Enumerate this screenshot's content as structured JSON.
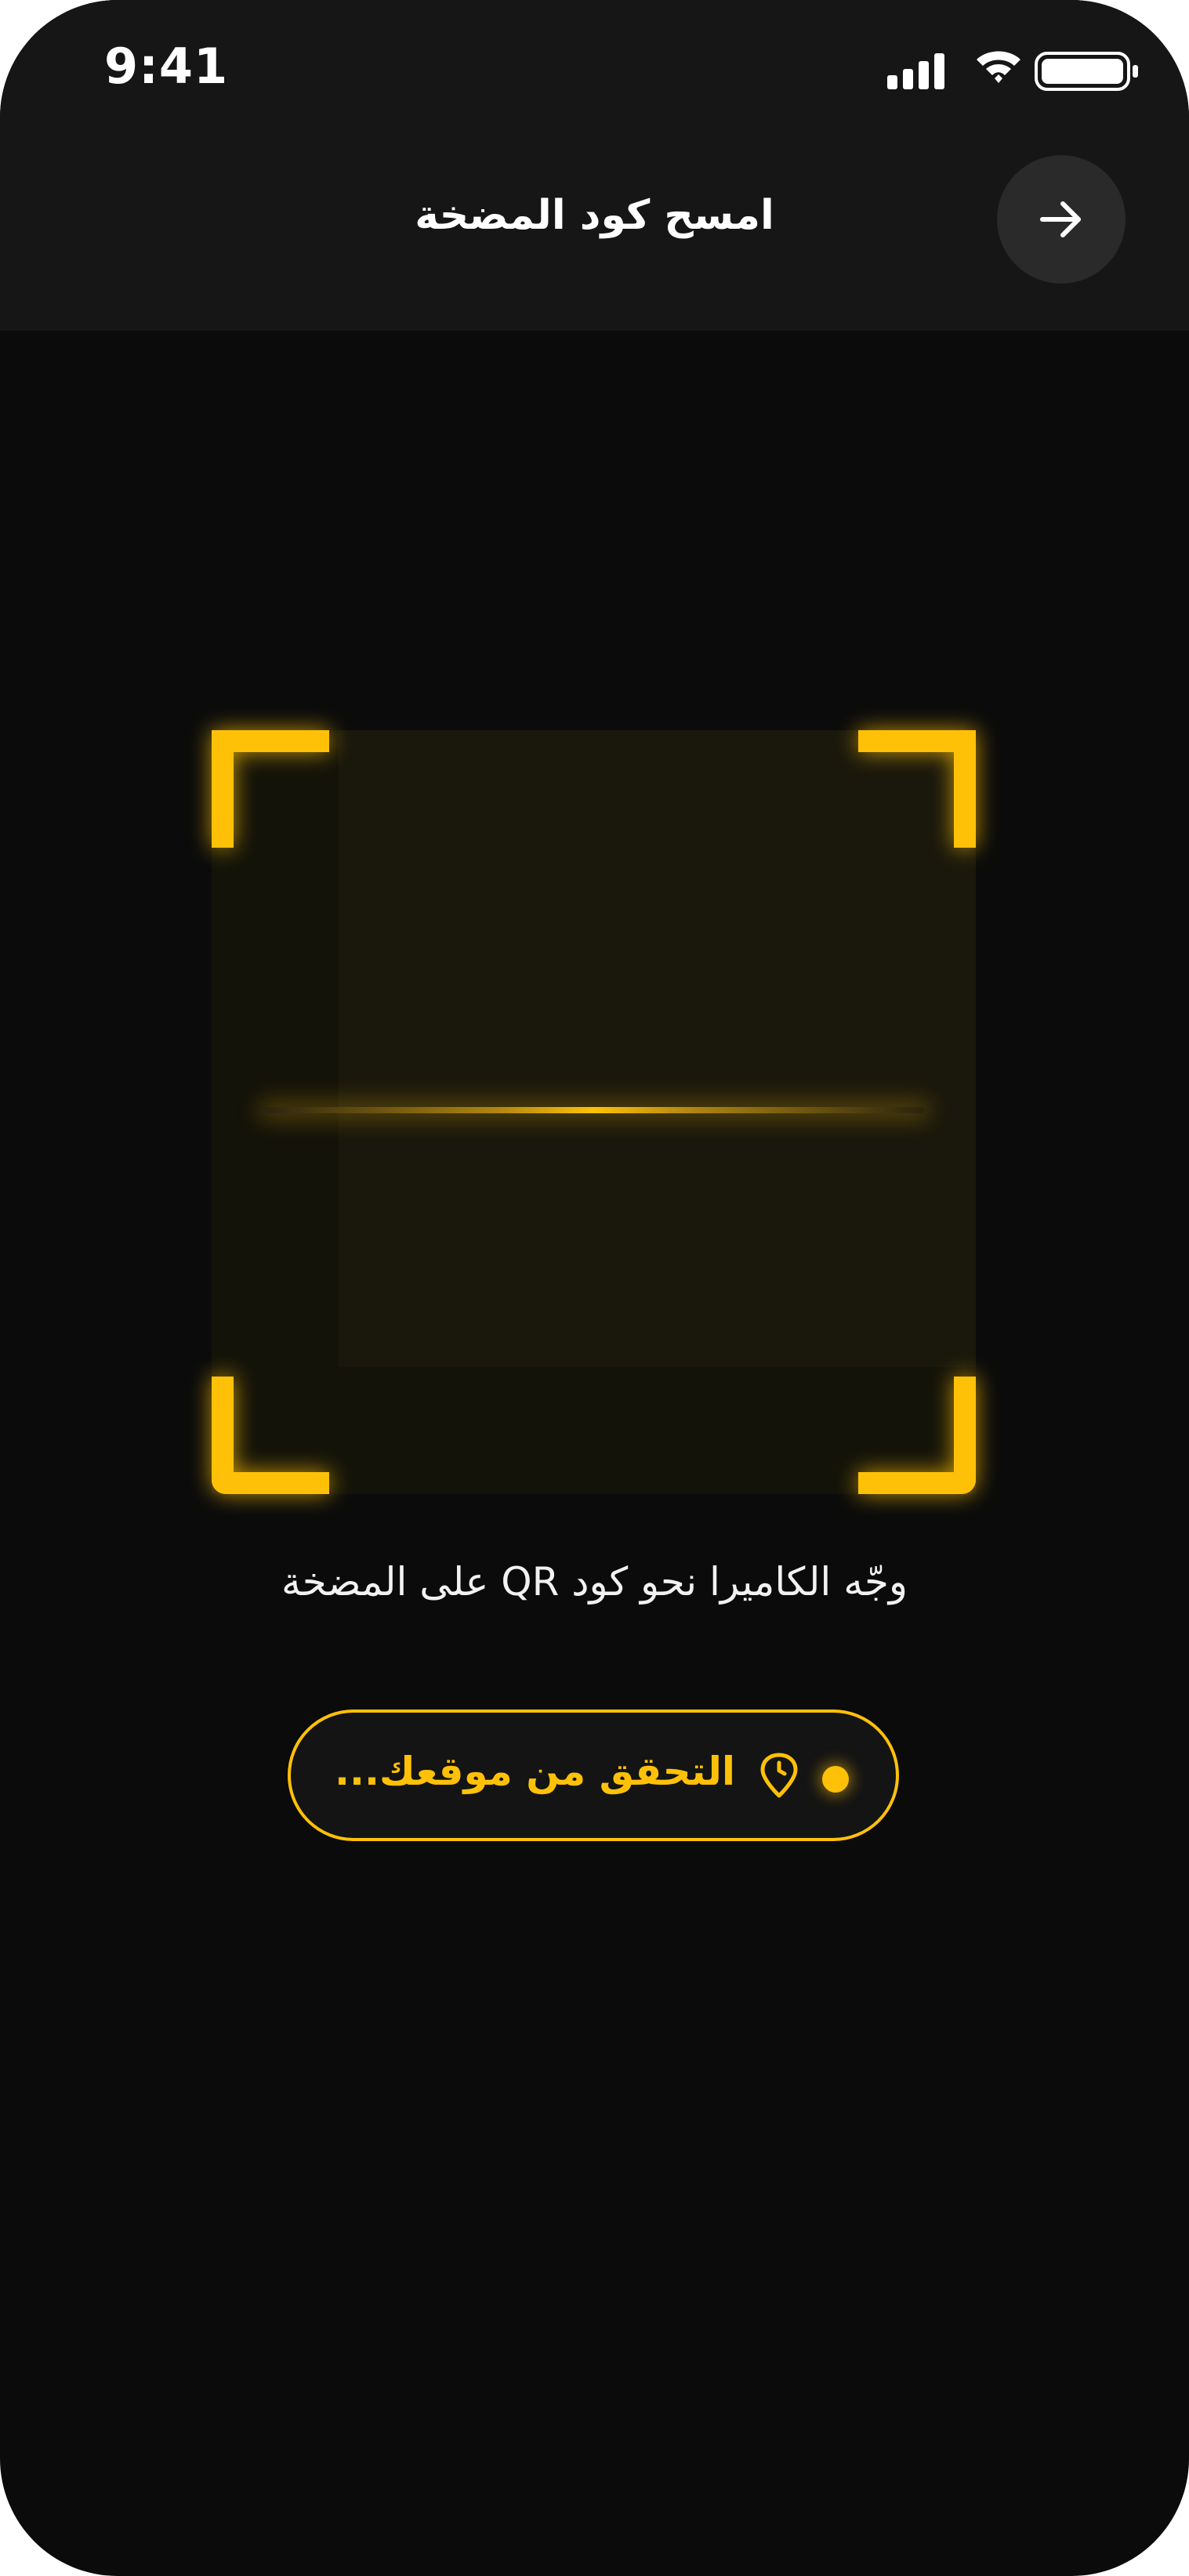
{
  "status_bar": {
    "time": "9:41"
  },
  "header": {
    "title": "امسح كود المضخة",
    "back_icon": "arrow-right-icon"
  },
  "scanner": {
    "instruction": "وجّه الكاميرا نحو كود QR على المضخة",
    "accent_color": "#FFC107"
  },
  "location_status": {
    "label": "التحقق من موقعك...",
    "icon": "location-pin-icon",
    "indicator_icon": "status-dot-icon"
  },
  "colors": {
    "background": "#0b0b0b",
    "header_background": "#161616",
    "accent": "#FFC107",
    "text": "#ffffff"
  }
}
